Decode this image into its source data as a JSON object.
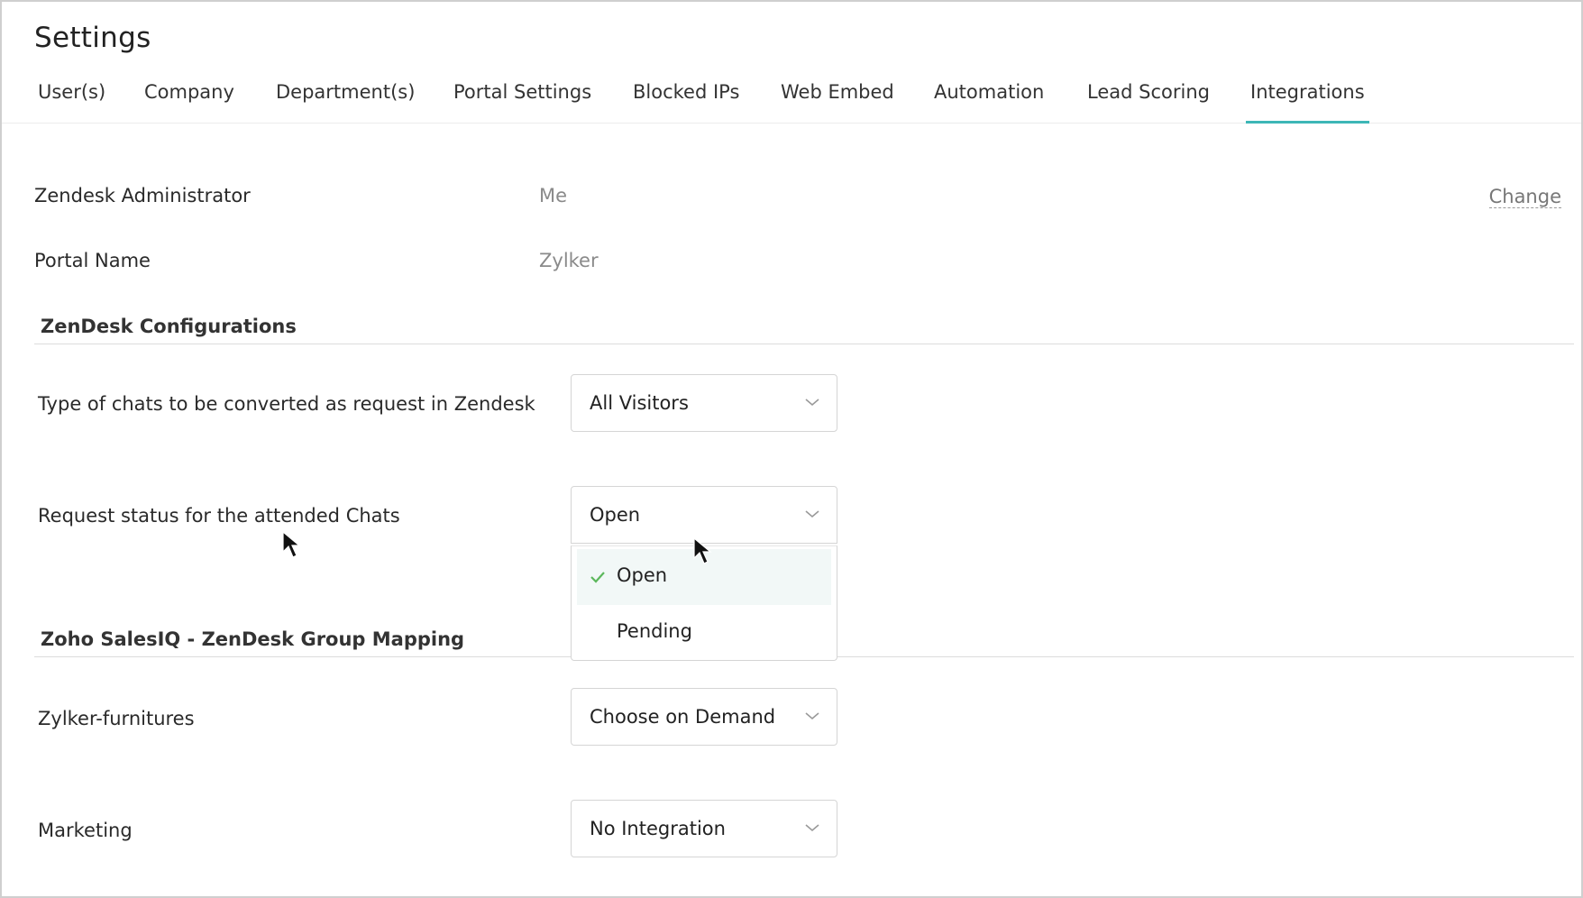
{
  "page": {
    "title": "Settings"
  },
  "tabs": [
    {
      "label": "User(s)"
    },
    {
      "label": "Company"
    },
    {
      "label": "Department(s)"
    },
    {
      "label": "Portal Settings"
    },
    {
      "label": "Blocked IPs"
    },
    {
      "label": "Web Embed"
    },
    {
      "label": "Automation"
    },
    {
      "label": "Lead Scoring"
    },
    {
      "label": "Integrations",
      "active": true
    }
  ],
  "info": {
    "admin_label": "Zendesk Administrator",
    "admin_value": "Me",
    "change_link": "Change",
    "portal_label": "Portal Name",
    "portal_value": "Zylker"
  },
  "config": {
    "heading": "ZenDesk Configurations",
    "chat_type_label": "Type of chats to be converted as request in Zendesk",
    "chat_type_value": "All Visitors",
    "status_label": "Request status for the attended Chats",
    "status_value": "Open",
    "status_options": [
      {
        "label": "Open",
        "selected": true
      },
      {
        "label": "Pending",
        "selected": false
      }
    ]
  },
  "mapping": {
    "heading": "Zoho SalesIQ - ZenDesk Group Mapping",
    "groups": [
      {
        "name": "Zylker-furnitures",
        "value": "Choose on Demand"
      },
      {
        "name": "Marketing",
        "value": "No Integration"
      }
    ]
  },
  "colors": {
    "accent": "#3db6b6",
    "check": "#5cb85c"
  }
}
